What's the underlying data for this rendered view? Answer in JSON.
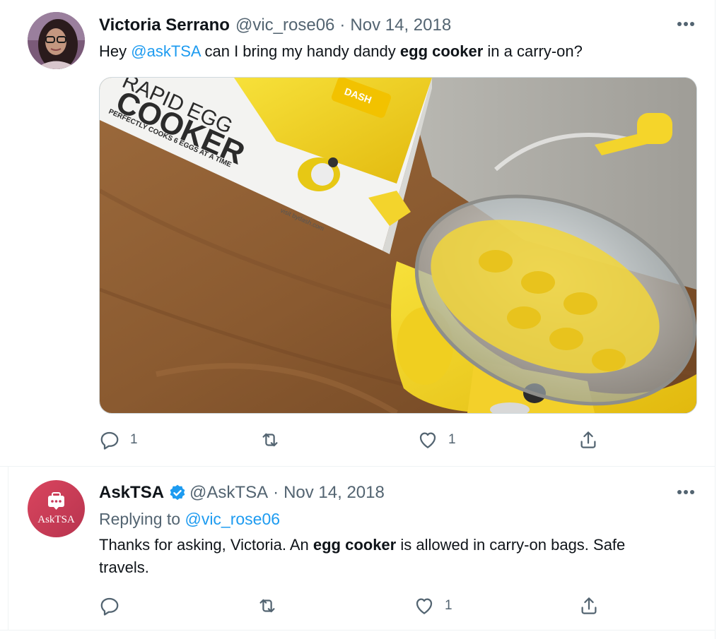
{
  "tweets": [
    {
      "name": "Victoria Serrano",
      "handle": "@vic_rose06",
      "separator": "·",
      "date": "Nov 14, 2018",
      "text": {
        "p1": "Hey ",
        "mention": "@askTSA",
        "p2": " can I bring my handy dandy ",
        "bold": "egg cooker",
        "p3": " in a carry-on?"
      },
      "media": {
        "box_line1": "RAPID EGG",
        "box_line2": "COOKER",
        "box_line3": "PERFECTLY COOKS 6 EGGS AT A TIME",
        "box_url": "visit bydash.com",
        "brand": "DASH"
      },
      "actions": {
        "replies": "1",
        "retweets": "",
        "likes": "1"
      }
    },
    {
      "name": "AskTSA",
      "handle": "@AskTSA",
      "separator": "·",
      "date": "Nov 14, 2018",
      "avatar_text": "AskTSA",
      "replying_label": "Replying to ",
      "replying_to": "@vic_rose06",
      "text": {
        "p1": "Thanks for asking, Victoria. An ",
        "bold": "egg cooker",
        "p2": " is allowed in carry-on bags. Safe",
        "p3": "travels."
      },
      "actions": {
        "replies": "",
        "retweets": "",
        "likes": "1"
      }
    }
  ],
  "colors": {
    "link": "#1d9bf0",
    "secondary": "#536471",
    "verified": "#1d9bf0",
    "tsa_avatar": "#c7385a"
  }
}
